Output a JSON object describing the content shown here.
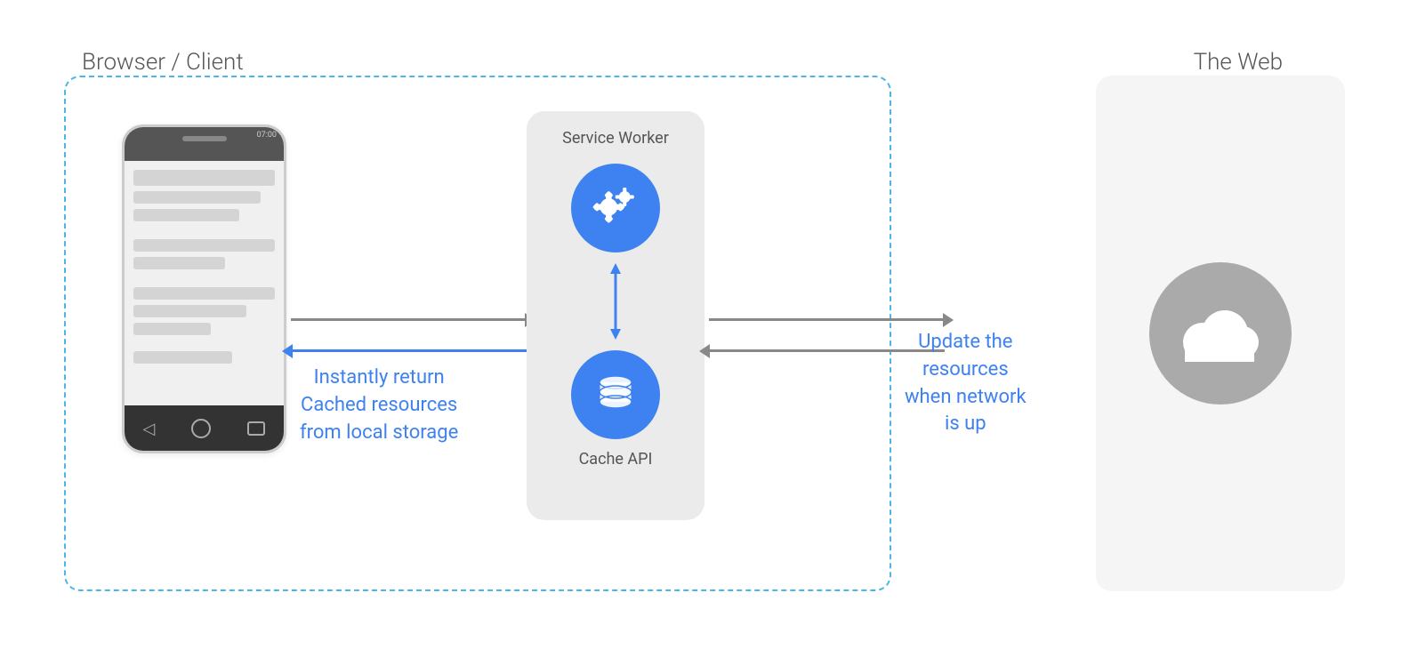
{
  "diagram": {
    "browser_client_label": "Browser / Client",
    "web_label": "The Web",
    "service_worker_label": "Service Worker",
    "cache_api_label": "Cache API",
    "instantly_return_line1": "Instantly return",
    "instantly_return_line2": "Cached resources",
    "instantly_return_line3": "from local storage",
    "update_label_line1": "Update the",
    "update_label_line2": "resources",
    "update_label_line3": "when network",
    "update_label_line4": "is up"
  }
}
